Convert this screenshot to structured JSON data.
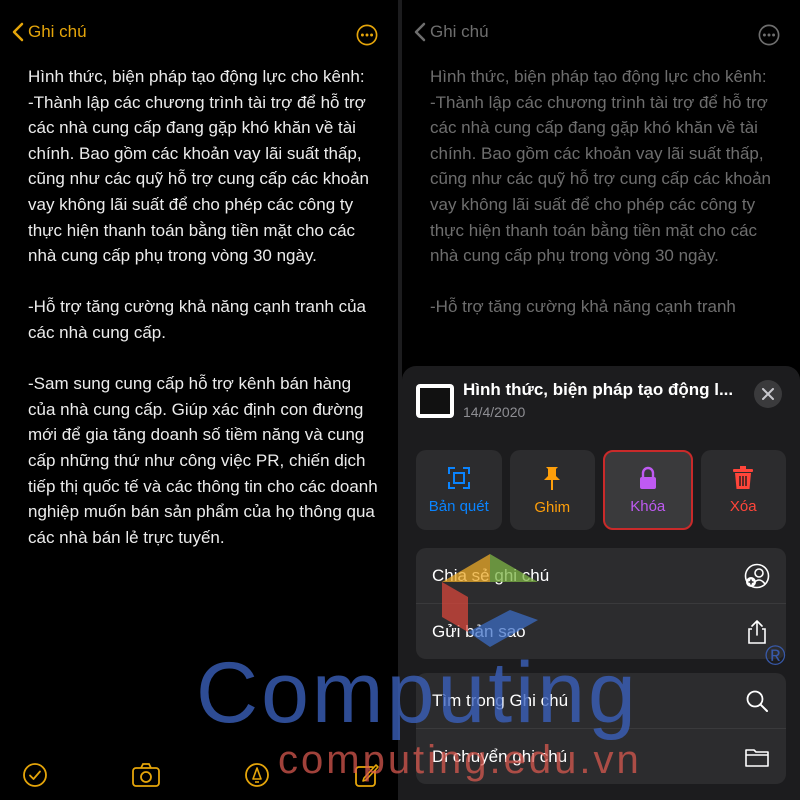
{
  "left": {
    "back_label": "Ghi chú",
    "note_text": "Hình thức, biện pháp tạo động lực cho kênh:\n-Thành lập các chương trình tài trợ để hỗ trợ các nhà cung cấp đang gặp khó khăn về tài chính. Bao gồm các khoản vay lãi suất thấp, cũng như các quỹ hỗ trợ cung cấp các khoản vay không lãi suất để cho phép các công ty thực hiện thanh toán bằng tiền mặt cho các nhà cung cấp phụ trong vòng 30 ngày.\n\n-Hỗ trợ tăng cường khả năng cạnh tranh của các nhà cung cấp.\n\n-Sam sung cung cấp hỗ trợ kênh bán hàng của nhà cung cấp. Giúp xác định con đường mới để gia tăng doanh số tiềm năng và cung cấp những thứ như công việc PR, chiến dịch tiếp thị quốc tế và các thông tin cho các doanh nghiệp muốn bán sản phẩm của họ thông qua các nhà bán lẻ trực tuyến."
  },
  "right": {
    "back_label": "Ghi chú",
    "note_text": "Hình thức, biện pháp tạo động lực cho kênh:\n-Thành lập các chương trình tài trợ để hỗ trợ các nhà cung cấp đang gặp khó khăn về tài chính. Bao gồm các khoản vay lãi suất thấp, cũng như các quỹ hỗ trợ cung cấp các khoản vay không lãi suất để cho phép các công ty thực hiện thanh toán bằng tiền mặt cho các nhà cung cấp phụ trong vòng 30 ngày.\n\n-Hỗ trợ tăng cường khả năng cạnh tranh",
    "sheet": {
      "title": "Hình thức, biện pháp tạo động l...",
      "date": "14/4/2020",
      "actions": [
        {
          "label": "Bản quét",
          "icon": "scan-icon",
          "color": "#0a84ff"
        },
        {
          "label": "Ghim",
          "icon": "pin-icon",
          "color": "#ff9f0a"
        },
        {
          "label": "Khóa",
          "icon": "lock-icon",
          "color": "#bf5af2"
        },
        {
          "label": "Xóa",
          "icon": "trash-icon",
          "color": "#ff453a"
        }
      ],
      "group1": [
        {
          "label": "Chia sẻ ghi chú",
          "icon": "share-person-icon"
        },
        {
          "label": "Gửi bản sao",
          "icon": "share-icon"
        }
      ],
      "group2": [
        {
          "label": "Tìm trong Ghi chú",
          "icon": "search-icon"
        },
        {
          "label": "Di chuyển ghi chú",
          "icon": "folder-icon"
        }
      ]
    }
  },
  "watermark": {
    "brand": "Computing",
    "site": "computing.edu.vn",
    "reg": "®"
  },
  "colors": {
    "accent": "#e5a50a",
    "background": "#000000",
    "sheet": "#1c1c1e",
    "highlight_border": "#c92a2a"
  }
}
